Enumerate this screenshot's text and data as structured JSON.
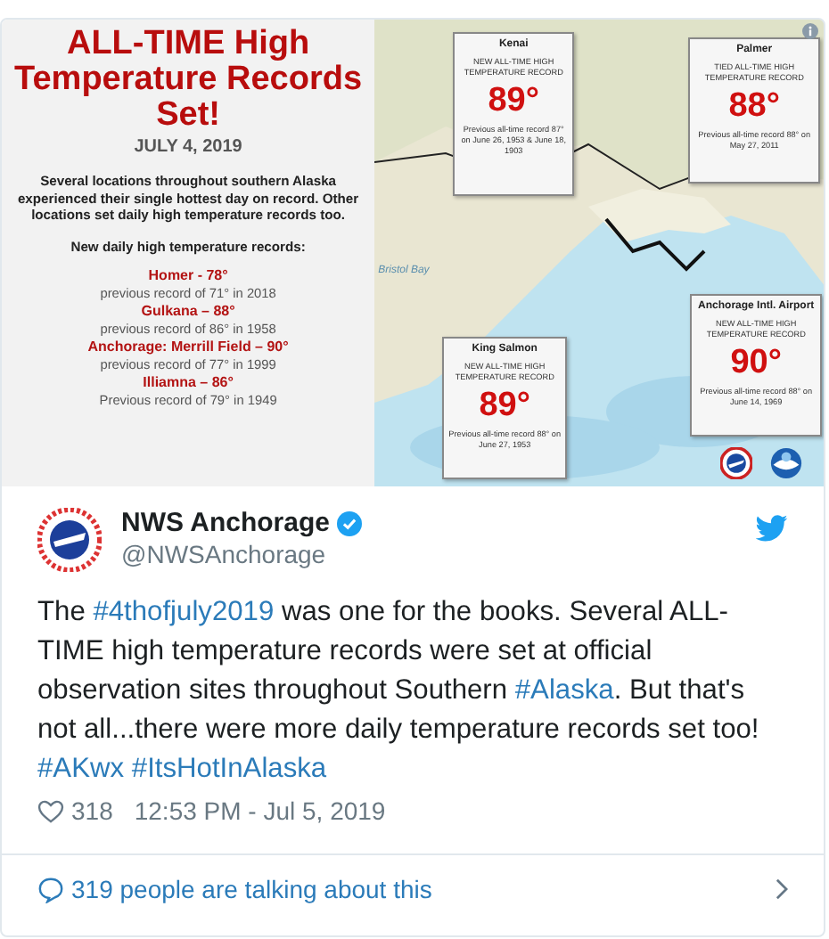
{
  "graphic": {
    "title": "ALL-TIME High Temperature Records Set!",
    "date": "JULY 4, 2019",
    "intro": "Several locations throughout southern Alaska experienced their single hottest day on record. Other locations set daily high temperature records too.",
    "daily_heading": "New daily high temperature records:",
    "daily_records": [
      {
        "station": "Homer - 78°",
        "previous": "previous record of 71° in 2018"
      },
      {
        "station": "Gulkana – 88°",
        "previous": "previous record of 86° in 1958"
      },
      {
        "station": "Anchorage: Merrill Field – 90°",
        "previous": "previous record of 77° in 1999"
      },
      {
        "station": "Illiamna – 86°",
        "previous": "Previous record of 79° in 1949"
      }
    ],
    "map_label": "Bristol Bay",
    "callouts": [
      {
        "place": "Kenai",
        "record": "NEW ALL-TIME HIGH TEMPERATURE RECORD",
        "temp": "89°",
        "previous": "Previous all-time record 87° on June 26, 1953 & June 18, 1903"
      },
      {
        "place": "Palmer",
        "record": "TIED ALL-TIME HIGH TEMPERATURE RECORD",
        "temp": "88°",
        "previous": "Previous all-time record 88° on May 27, 2011"
      },
      {
        "place": "Anchorage Intl. Airport",
        "record": "NEW ALL-TIME HIGH TEMPERATURE RECORD",
        "temp": "90°",
        "previous": "Previous all-time record 88° on June 14, 1969"
      },
      {
        "place": "King Salmon",
        "record": "NEW ALL-TIME HIGH TEMPERATURE RECORD",
        "temp": "89°",
        "previous": "Previous all-time record 88° on June 27, 1953"
      }
    ]
  },
  "tweet": {
    "name": "NWS Anchorage",
    "verified": true,
    "handle": "@NWSAnchorage",
    "text": [
      {
        "kind": "text",
        "text": "The "
      },
      {
        "kind": "hashtag",
        "text": "#4thofjuly2019"
      },
      {
        "kind": "text",
        "text": " was one for the books. Several ALL-TIME high temperature records were set at official observation sites throughout Southern "
      },
      {
        "kind": "hashtag",
        "text": "#Alaska"
      },
      {
        "kind": "text",
        "text": ". But that's not all...there were more daily temperature records set too! "
      },
      {
        "kind": "hashtag",
        "text": "#AKwx"
      },
      {
        "kind": "hashtag",
        "text": "#ItsHotInAlaska"
      }
    ],
    "likes": "318",
    "time": "12:53 PM - Jul 5, 2019",
    "talking": "319 people are talking about this"
  }
}
